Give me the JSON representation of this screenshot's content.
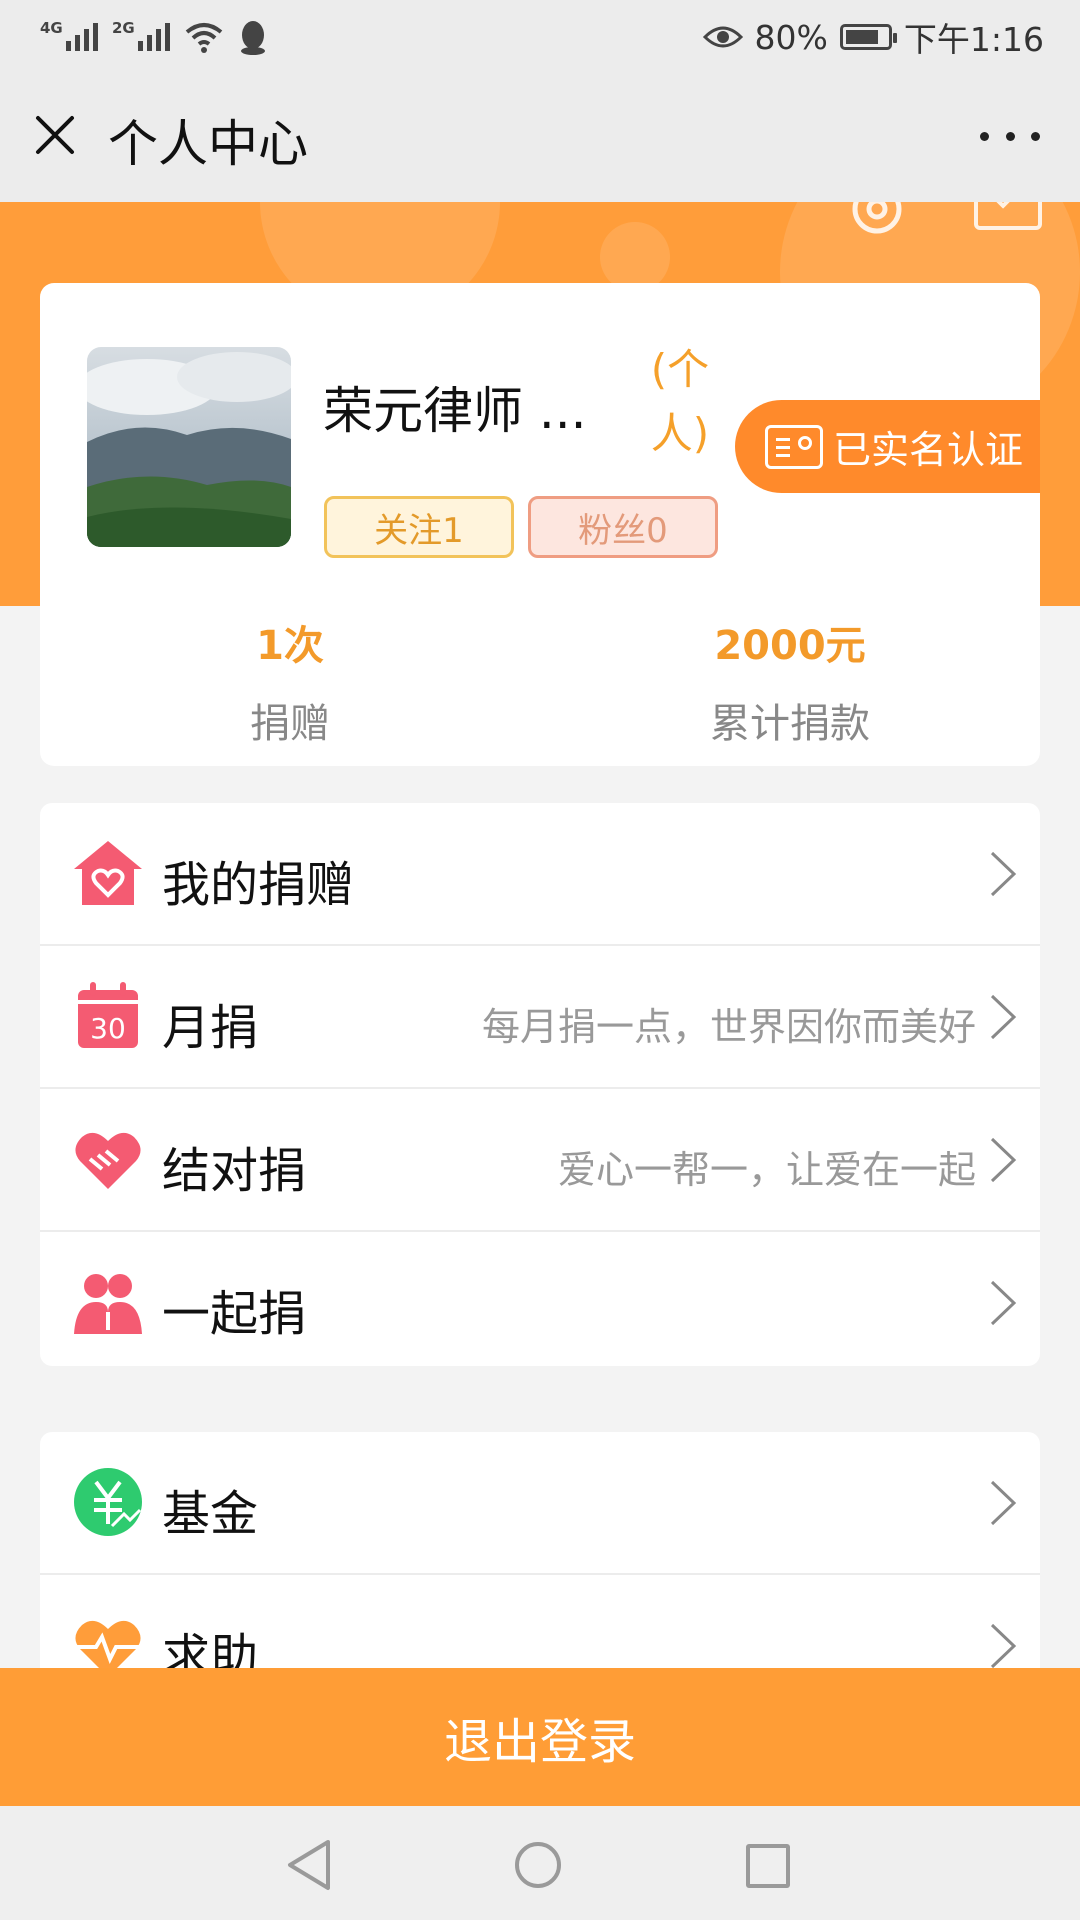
{
  "status_bar": {
    "network_1": "4G",
    "network_2": "2G",
    "battery_percent": "80%",
    "battery_level": 0.8,
    "time": "下午1:16"
  },
  "title_bar": {
    "title": "个人中心"
  },
  "profile": {
    "name": "荣元律师 ...",
    "account_type": "(个人)",
    "verified_label": "已实名认证",
    "follow_label": "关注1",
    "fans_label": "粉丝0",
    "stats": [
      {
        "value": "1次",
        "label": "捐赠"
      },
      {
        "value": "2000元",
        "label": "累计捐款"
      }
    ]
  },
  "menu_group_1": [
    {
      "label": "我的捐赠",
      "subtitle": "",
      "icon": "house-heart-icon"
    },
    {
      "label": "月捐",
      "subtitle": "每月捐一点，世界因你而美好",
      "icon": "calendar-icon"
    },
    {
      "label": "结对捐",
      "subtitle": "爱心一帮一，让爱在一起",
      "icon": "handshake-heart-icon"
    },
    {
      "label": "一起捐",
      "subtitle": "",
      "icon": "people-icon"
    }
  ],
  "menu_group_2": [
    {
      "label": "基金",
      "subtitle": "",
      "icon": "yuan-icon"
    },
    {
      "label": "求助",
      "subtitle": "",
      "icon": "heartbeat-icon"
    }
  ],
  "calendar_icon_number": "30",
  "logout_label": "退出登录",
  "colors": {
    "brand_orange": "#ff9d3a",
    "stat_orange": "#f39a2a",
    "icon_pink": "#f45b72",
    "icon_green": "#2ecb6f"
  }
}
